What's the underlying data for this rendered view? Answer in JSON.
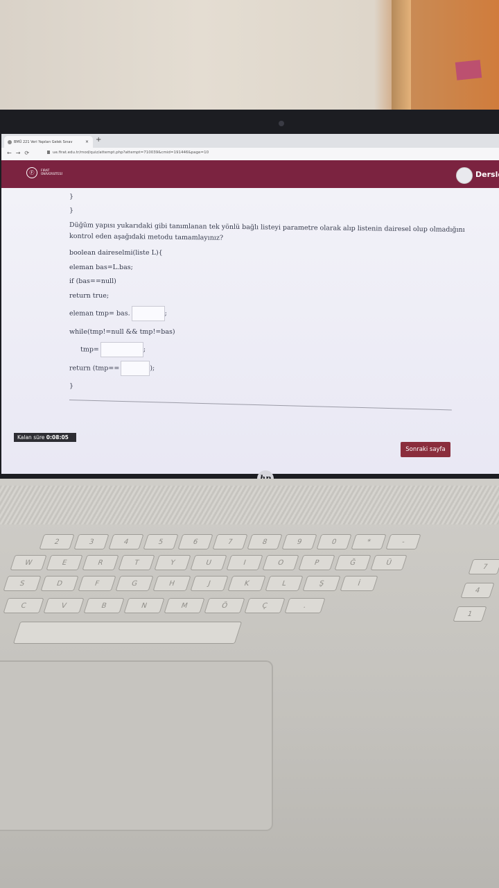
{
  "browser": {
    "tab_title": "BMÜ 221 Veri Yapıları Gelek Sınav",
    "tab_close": "×",
    "new_tab": "+",
    "url": "ue.firat.edu.tr/mod/quiz/attempt.php?attempt=710039&cmid=191446&page=10"
  },
  "site": {
    "logo_mark": "Ⓕ",
    "logo_text": "FIRAT ÜNİVERSİTESİ",
    "nav_right": "Dersler"
  },
  "question": {
    "lines": [
      "}",
      "}",
      "Düğüm yapısı yukarıdaki gibi tanımlanan tek yönlü bağlı listeyi parametre olarak alıp listenin dairesel olup olmadığını",
      "kontrol eden aşağıdaki metodu tamamlayınız?",
      "boolean daireselmi(liste L){",
      "eleman bas=L.bas;",
      "if (bas==null)",
      "return true;",
      "eleman tmp= bas.",
      ";",
      "while(tmp!=null && tmp!=bas)",
      "tmp=",
      ";",
      "return (tmp==",
      ");",
      "}"
    ]
  },
  "quiz": {
    "timer_label": "Kalan süre",
    "timer_value": "0:08:05",
    "next_button": "Sonraki sayfa"
  },
  "laptop": {
    "brand": "hp"
  },
  "keyboard": {
    "row1": [
      "2",
      "3",
      "4",
      "5",
      "6",
      "7",
      "8",
      "9",
      "0",
      "*",
      "-"
    ],
    "row2": [
      "W",
      "E",
      "R",
      "T",
      "Y",
      "U",
      "I",
      "O",
      "P",
      "Ğ",
      "Ü"
    ],
    "row3": [
      "S",
      "D",
      "F",
      "G",
      "H",
      "J",
      "K",
      "L",
      "Ş",
      "İ"
    ],
    "row4": [
      "C",
      "V",
      "B",
      "N",
      "M",
      "Ö",
      "Ç",
      "."
    ],
    "numpad": [
      "7",
      "4",
      "1"
    ]
  }
}
